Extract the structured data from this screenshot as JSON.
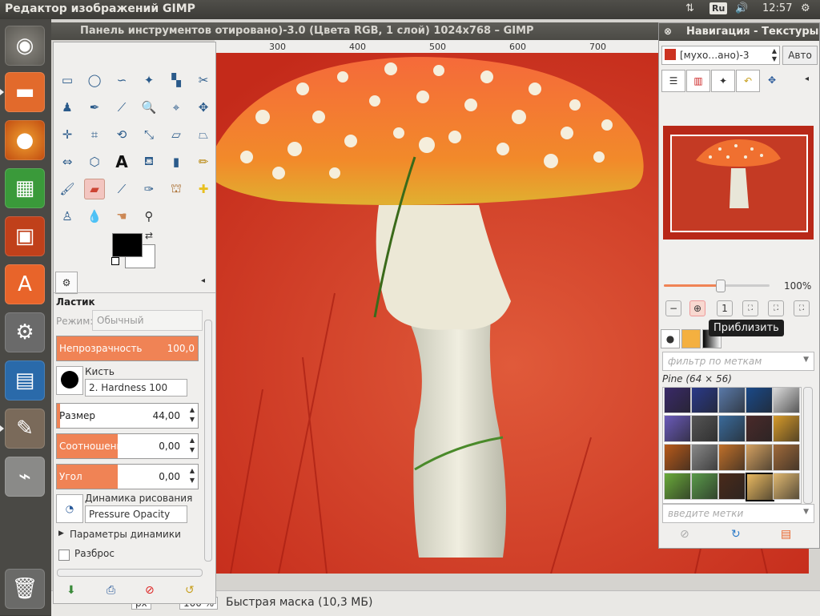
{
  "top_panel": {
    "app_title": "Редактор изображений GIMP",
    "keyboard_layout": "Ru",
    "clock": "12:57",
    "icons": [
      "arrows-updown-icon",
      "keyboard-indicator-icon",
      "volume-icon",
      "settings-gear-icon"
    ]
  },
  "launcher": {
    "items": [
      "ubuntu-dash-icon",
      "files-icon",
      "firefox-icon",
      "calc-icon",
      "impress-icon",
      "software-center-icon",
      "system-settings-icon",
      "writer-icon",
      "gimp-icon",
      "usb-drive-icon",
      "trash-icon"
    ]
  },
  "canvas": {
    "title": "Панель инструментов отировано)-3.0 (Цвета RGB, 1 слой) 1024x768 – GIMP",
    "ruler_ticks": [
      "300",
      "400",
      "500",
      "600",
      "700"
    ],
    "statusbar": {
      "zoom_left": "px",
      "zoom_value": "100 %",
      "message": "Быстрая маска (10,3 МБ)"
    }
  },
  "toolbox": {
    "tool_name": "Ластик",
    "mode_label": "Режим:",
    "mode_value": "Обычный",
    "opacity_label": "Непрозрачность",
    "opacity_value": "100,0",
    "opacity_fraction": 1.0,
    "brush_label": "Кисть",
    "brush_value": "2. Hardness 100",
    "size_label": "Размер",
    "size_value": "44,00",
    "aspect_label": "Соотношение с...",
    "aspect_value": "0,00",
    "angle_label": "Угол",
    "angle_value": "0,00",
    "dynamics_label": "Динамика рисования",
    "dynamics_value": "Pressure Opacity",
    "dynamics_params": "Параметры динамики",
    "scatter_label": "Разброс",
    "fg_color": "#000000",
    "bg_color": "#ffffff"
  },
  "dock": {
    "title": "Навигация - Текстуры",
    "image_selector": "[мухо…ано)-3",
    "auto_button": "Авто",
    "zoom_percent": "100%",
    "zoom_slider_fraction": 0.53,
    "tooltip": "Приблизить",
    "tag_filter_placeholder": "фильтр по меткам",
    "pattern_name": "Pine (64 × 56)",
    "tag_input_placeholder": "введите метки",
    "pattern_colors": [
      [
        "#3a2a6a",
        "#2a3a8a",
        "#5a7aaa",
        "#1a4a8a",
        "#dddddd"
      ],
      [
        "#6a5aba",
        "#555555",
        "#3a6a9a",
        "#4a2a2a",
        "#d69a2a"
      ],
      [
        "#b85a1a",
        "#888888",
        "#c0702a",
        "#d4a060",
        "#a06a3a"
      ],
      [
        "#6aaa3a",
        "#5a9a4a",
        "#4a2a1a",
        "#e8b860",
        "#e0b870"
      ]
    ]
  },
  "colors": {
    "accent": "#f08355",
    "panel_bg": "#3c3b37",
    "launcher_bg": "#4a4945",
    "image_red": "#d63a28"
  }
}
